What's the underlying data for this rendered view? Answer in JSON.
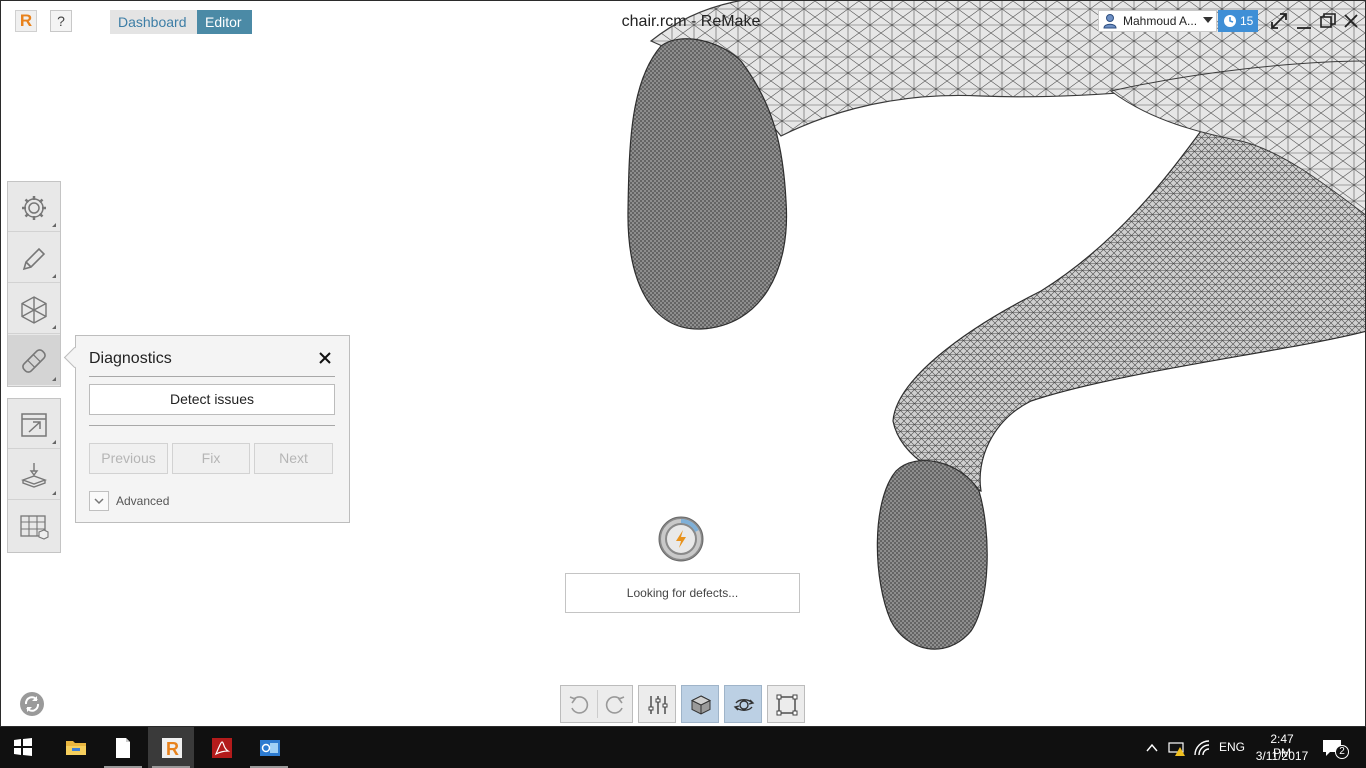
{
  "app": {
    "title": "chair.rcm - ReMake",
    "logo_letter": "R",
    "help_label": "?",
    "brand_color": "#e8821c"
  },
  "tabs": [
    {
      "label": "Dashboard",
      "active": false
    },
    {
      "label": "Editor",
      "active": true
    }
  ],
  "user": {
    "name": "Mahmoud A...",
    "icon": "user-icon"
  },
  "notifications": {
    "count": "15",
    "icon": "clock-icon",
    "color": "#3f8fd6"
  },
  "sidebar": {
    "group1": [
      {
        "icon": "gear-icon",
        "name": "settings"
      },
      {
        "icon": "pencil-icon",
        "name": "edit"
      },
      {
        "icon": "hexagon-mesh-icon",
        "name": "mesh"
      },
      {
        "icon": "bandage-icon",
        "name": "diagnostics",
        "active": true
      }
    ],
    "group2": [
      {
        "icon": "export-icon",
        "name": "export"
      },
      {
        "icon": "print-3d-icon",
        "name": "print"
      },
      {
        "icon": "grid-cube-icon",
        "name": "scene"
      }
    ]
  },
  "diagnostics": {
    "title": "Diagnostics",
    "detect_label": "Detect issues",
    "previous_label": "Previous",
    "fix_label": "Fix",
    "next_label": "Next",
    "advanced_label": "Advanced"
  },
  "status": {
    "message": "Looking for defects..."
  },
  "bottom_toolbar": [
    {
      "icon": "undo-icon"
    },
    {
      "icon": "redo-icon"
    },
    {
      "icon": "sliders-icon"
    },
    {
      "icon": "cube-icon",
      "active": true
    },
    {
      "icon": "orbit-icon",
      "active": true
    },
    {
      "icon": "selection-box-icon"
    }
  ],
  "taskbar": {
    "apps": [
      {
        "icon": "file-explorer-icon"
      },
      {
        "icon": "document-icon"
      },
      {
        "icon": "remake-app-icon",
        "active": true
      },
      {
        "icon": "acrobat-icon"
      },
      {
        "icon": "outlook-icon"
      }
    ],
    "language": "ENG",
    "time": "2:47 PM",
    "date": "3/11/2017",
    "notification_count": "2"
  }
}
